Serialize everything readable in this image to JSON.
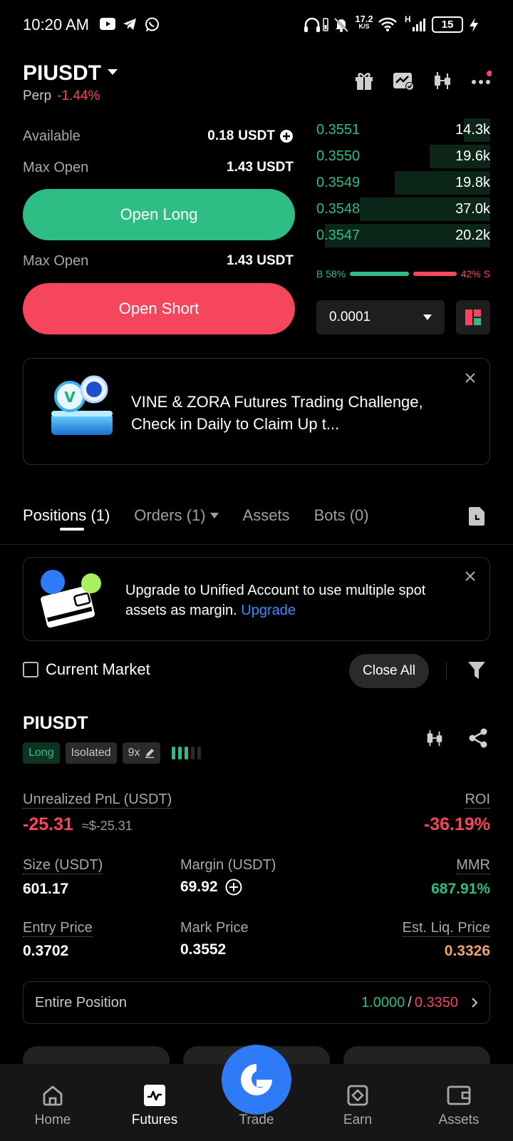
{
  "status_bar": {
    "time": "10:20 AM",
    "speed_value": "17.2",
    "speed_unit": "K/S",
    "network": "H",
    "battery": "15"
  },
  "header": {
    "pair": "PIUSDT",
    "contract_type": "Perp",
    "change": "-1.44%",
    "icons": [
      "gift-icon",
      "chart-check-icon",
      "candlestick-icon",
      "more-icon"
    ]
  },
  "trade_panel": {
    "available_label": "Available",
    "available_value": "0.18",
    "available_unit": "USDT",
    "max_open_label_1": "Max Open",
    "max_open_value_1": "1.43 USDT",
    "open_long": "Open Long",
    "max_open_label_2": "Max Open",
    "max_open_value_2": "1.43 USDT",
    "open_short": "Open Short"
  },
  "order_book": {
    "rows": [
      {
        "price": "0.3551",
        "amount": "14.3k",
        "depth": 0.15
      },
      {
        "price": "0.3550",
        "amount": "19.6k",
        "depth": 0.35
      },
      {
        "price": "0.3549",
        "amount": "19.8k",
        "depth": 0.55
      },
      {
        "price": "0.3548",
        "amount": "37.0k",
        "depth": 0.75
      },
      {
        "price": "0.3547",
        "amount": "20.2k",
        "depth": 0.95
      }
    ],
    "buy_label": "B 58%",
    "sell_label": "42% S",
    "buy_ratio": 0.58,
    "precision": "0.0001"
  },
  "promo": {
    "text": "VINE & ZORA Futures Trading Challenge, Check in Daily to Claim Up t..."
  },
  "tabs": [
    {
      "label": "Positions (1)"
    },
    {
      "label": "Orders (1)"
    },
    {
      "label": "Assets"
    },
    {
      "label": "Bots (0)"
    }
  ],
  "unified": {
    "text": "Upgrade to Unified Account to use multiple spot assets as margin.",
    "link": "Upgrade"
  },
  "filters": {
    "current_market": "Current Market",
    "close_all": "Close All"
  },
  "position": {
    "symbol": "PIUSDT",
    "side": "Long",
    "margin_mode": "Isolated",
    "leverage": "9x",
    "unrealized_label": "Unrealized PnL (USDT)",
    "unrealized_value": "-25.31",
    "unrealized_usd": "≈$-25.31",
    "roi_label": "ROI",
    "roi_value": "-36.19%",
    "size_label": "Size (USDT)",
    "size_value": "601.17",
    "margin_label": "Margin (USDT)",
    "margin_value": "69.92",
    "mmr_label": "MMR",
    "mmr_value": "687.91%",
    "entry_label": "Entry Price",
    "entry_value": "0.3702",
    "mark_label": "Mark Price",
    "mark_value": "0.3552",
    "liq_label": "Est. Liq. Price",
    "liq_value": "0.3326",
    "entire_label": "Entire Position",
    "tp_value": "1.0000",
    "separator": "/",
    "sl_value": "0.3350"
  },
  "bottom_nav": [
    {
      "label": "Home"
    },
    {
      "label": "Futures"
    },
    {
      "label": "Trade"
    },
    {
      "label": "Earn"
    },
    {
      "label": "Assets"
    }
  ],
  "colors": {
    "green": "#2ebd85",
    "red": "#f6465d",
    "blue": "#2f7af6",
    "orange": "#f0a36e"
  }
}
